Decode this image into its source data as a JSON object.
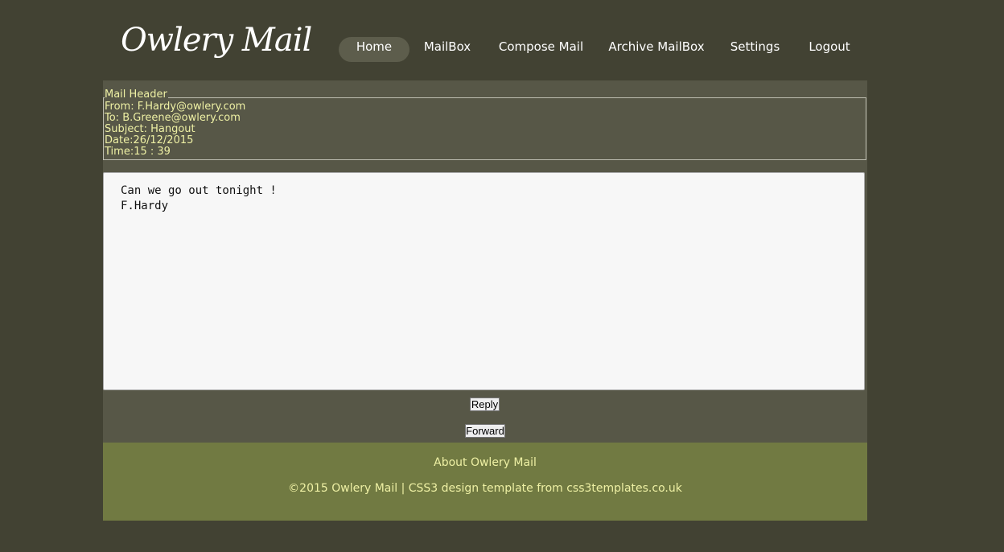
{
  "app": {
    "logo_text": "Owlery Mail"
  },
  "nav": {
    "items": [
      {
        "label": "Home",
        "active": true
      },
      {
        "label": "MailBox"
      },
      {
        "label": "Compose Mail"
      },
      {
        "label": "Archive MailBox"
      },
      {
        "label": "Settings"
      },
      {
        "label": "Logout"
      }
    ]
  },
  "mail_header": {
    "legend": "Mail Header",
    "from": "From: F.Hardy@owlery.com",
    "to": "To: B.Greene@owlery.com",
    "subject": "Subject: Hangout",
    "date": "Date:26/12/2015",
    "time": "Time:15 : 39"
  },
  "mail_body": {
    "lines": [
      "Can we go out tonight !",
      "F.Hardy"
    ]
  },
  "actions": {
    "reply_label": "Reply",
    "forward_label": "Forward"
  },
  "footer": {
    "about": "About Owlery Mail",
    "copyright": "©2015 Owlery Mail | CSS3 design template from css3templates.co.uk"
  },
  "colors": {
    "page_bg": "#424233",
    "panel_bg": "#575747",
    "footer_bg": "#717a42",
    "header_text": "#eef0a4",
    "nav_active_bg": "#5d5d4c"
  }
}
